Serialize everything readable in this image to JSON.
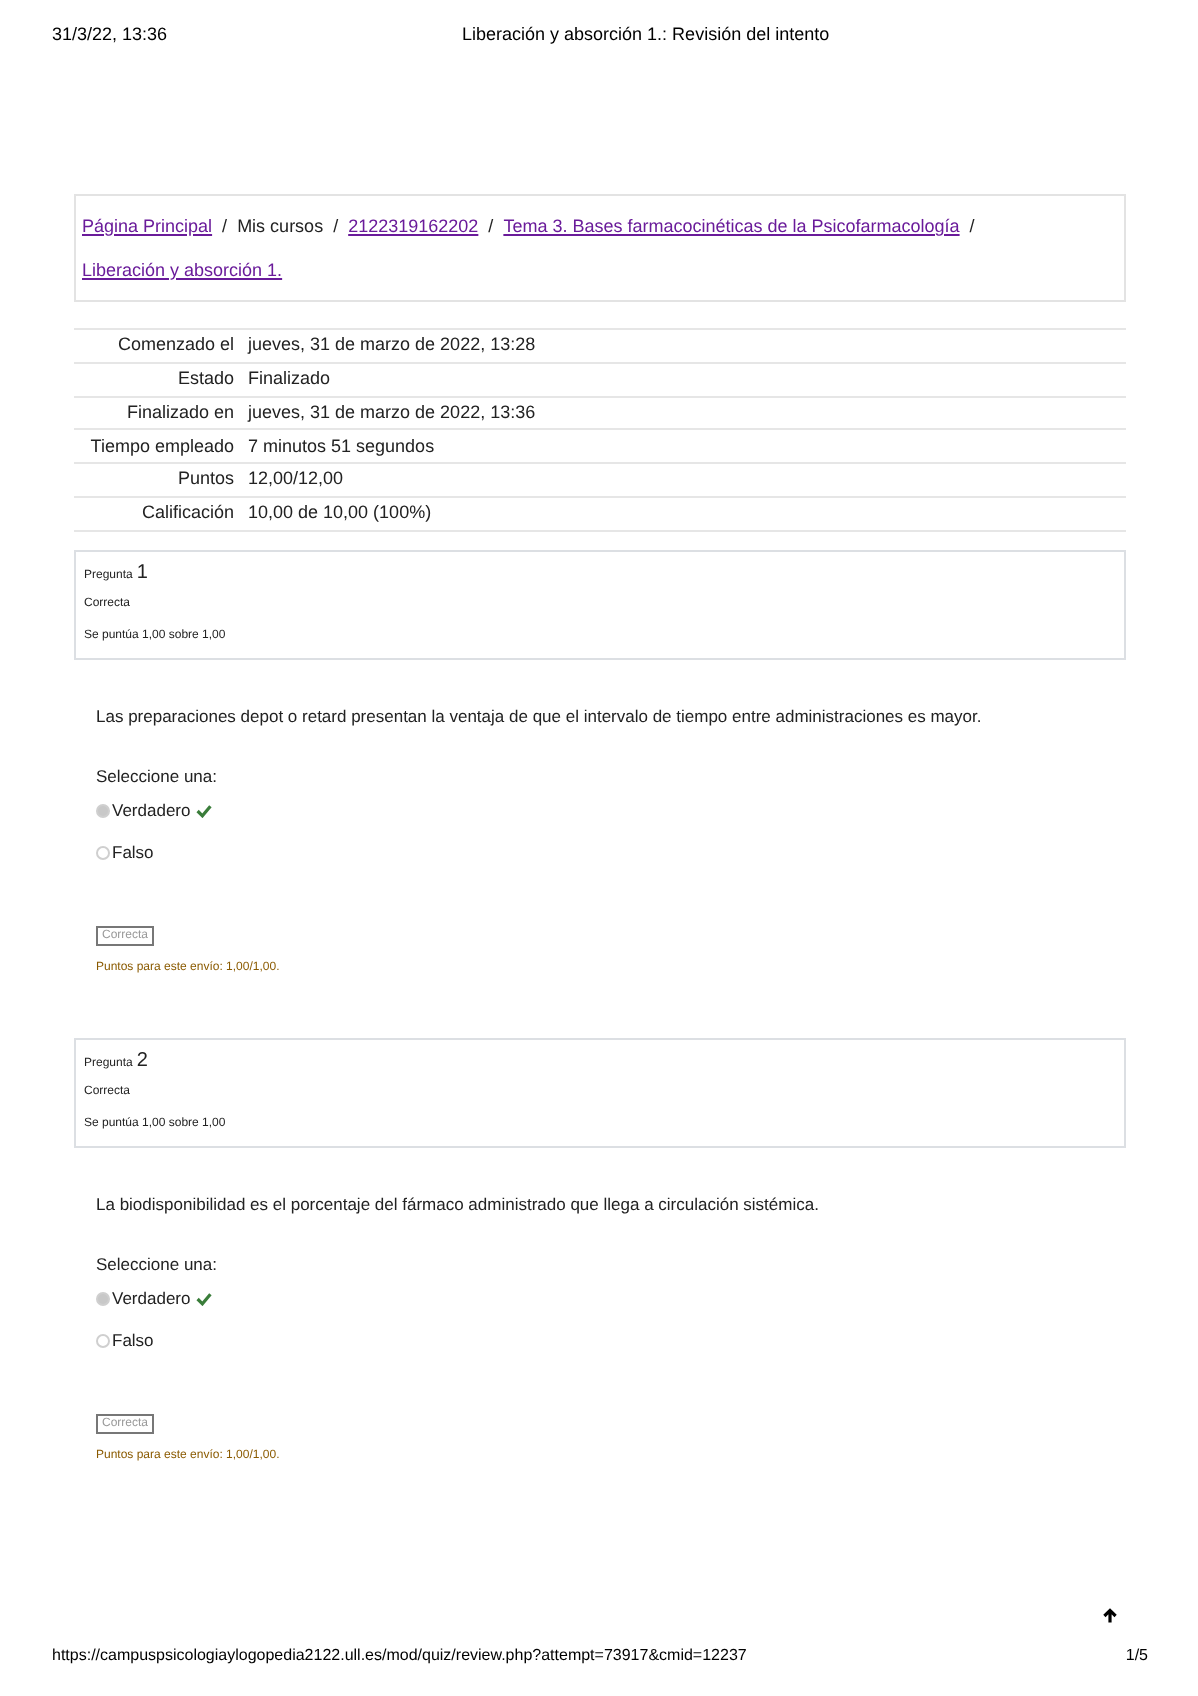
{
  "print_header": {
    "datetime": "31/3/22, 13:36",
    "title": "Liberación y absorción 1.: Revisión del intento"
  },
  "breadcrumb": [
    {
      "label": "Página Principal",
      "link": true
    },
    {
      "separator": "/",
      "label": "Mis cursos",
      "link": false
    },
    {
      "separator": "/",
      "label": "2122319162202",
      "link": true
    },
    {
      "separator": "/",
      "label": "Tema 3. Bases farmacocinéticas de la Psicofarmacología",
      "link": true
    },
    {
      "separator": "/",
      "label": "Liberación y absorción 1.",
      "link": true
    }
  ],
  "summary": [
    {
      "label": "Comenzado el",
      "value": "jueves, 31 de marzo de 2022, 13:28"
    },
    {
      "label": "Estado",
      "value": "Finalizado"
    },
    {
      "label": "Finalizado en",
      "value": "jueves, 31 de marzo de 2022, 13:36"
    },
    {
      "label": "Tiempo empleado",
      "value": "7 minutos 51 segundos"
    },
    {
      "label": "Puntos",
      "value": "12,00/12,00"
    },
    {
      "label": "Calificación",
      "value": "10,00 de 10,00 (100%)"
    }
  ],
  "questions": [
    {
      "label": "Pregunta",
      "number": "1",
      "status": "Correcta",
      "grade": "Se puntúa 1,00 sobre 1,00",
      "text": "Las preparaciones depot o retard presentan la ventaja de que el intervalo de tiempo entre administraciones es mayor.",
      "prompt": "Seleccione una:",
      "options": [
        {
          "label": "Verdadero",
          "selected": true,
          "correct": true
        },
        {
          "label": "Falso",
          "selected": false,
          "correct": false
        }
      ],
      "feedback_button": "Correcta",
      "score": "Puntos para este envío: 1,00/1,00."
    },
    {
      "label": "Pregunta",
      "number": "2",
      "status": "Correcta",
      "grade": "Se puntúa 1,00 sobre 1,00",
      "text": "La biodisponibilidad es el porcentaje del fármaco administrado que llega a circulación sistémica.",
      "prompt": "Seleccione una:",
      "options": [
        {
          "label": "Verdadero",
          "selected": true,
          "correct": true
        },
        {
          "label": "Falso",
          "selected": false,
          "correct": false
        }
      ],
      "feedback_button": "Correcta",
      "score": "Puntos para este envío: 1,00/1,00."
    }
  ],
  "print_footer": {
    "url": "https://campuspsicologiaylogopedia2122.ull.es/mod/quiz/review.php?attempt=73917&cmid=12237",
    "page": "1/5"
  }
}
